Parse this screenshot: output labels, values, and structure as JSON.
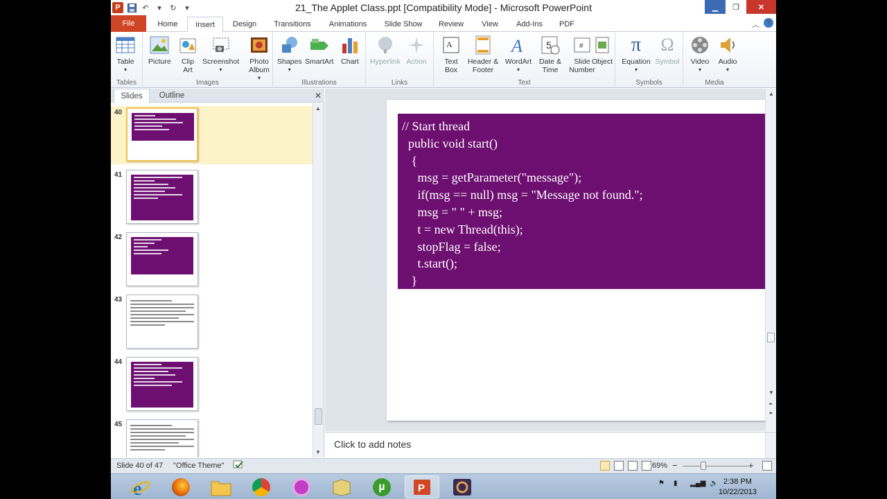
{
  "window": {
    "title": "21_The Applet Class.ppt [Compatibility Mode]  -  Microsoft PowerPoint",
    "app_letter": "P"
  },
  "tabs": [
    "File",
    "Home",
    "Insert",
    "Design",
    "Transitions",
    "Animations",
    "Slide Show",
    "Review",
    "View",
    "Add-Ins",
    "PDF"
  ],
  "active_tab": "Insert",
  "ribbon": {
    "groups": [
      {
        "label": "Tables",
        "buttons": [
          "Table"
        ]
      },
      {
        "label": "Images",
        "buttons": [
          "Picture",
          "Clip Art",
          "Screenshot",
          "Photo Album"
        ]
      },
      {
        "label": "Illustrations",
        "buttons": [
          "Shapes",
          "SmartArt",
          "Chart"
        ]
      },
      {
        "label": "Links",
        "buttons": [
          "Hyperlink",
          "Action"
        ]
      },
      {
        "label": "Text",
        "buttons": [
          "Text Box",
          "Header & Footer",
          "WordArt",
          "Date & Time",
          "Slide Number",
          "Object"
        ]
      },
      {
        "label": "Symbols",
        "buttons": [
          "Equation",
          "Symbol"
        ]
      },
      {
        "label": "Media",
        "buttons": [
          "Video",
          "Audio"
        ]
      }
    ]
  },
  "left_pane": {
    "tabs": [
      "Slides",
      "Outline"
    ],
    "active": "Slides",
    "thumbnails": [
      {
        "number": "40",
        "style": "purple",
        "selected": true
      },
      {
        "number": "41",
        "style": "purple",
        "selected": false
      },
      {
        "number": "42",
        "style": "purple",
        "selected": false
      },
      {
        "number": "43",
        "style": "text",
        "selected": false
      },
      {
        "number": "44",
        "style": "purple",
        "selected": false
      },
      {
        "number": "45",
        "style": "text",
        "selected": false
      }
    ]
  },
  "slide": {
    "code_lines": [
      "// Start thread",
      "  public void start()",
      "   {",
      "     msg = getParameter(\"message\");",
      "     if(msg == null) msg = \"Message not found.\";",
      "     msg = \" \" + msg;",
      "     t = new Thread(this);",
      "     stopFlag = false;",
      "     t.start();",
      "   }"
    ],
    "box_color": "#6d0f70"
  },
  "notes": {
    "placeholder": "Click to add notes"
  },
  "status": {
    "slide_info": "Slide 40 of 47",
    "theme": "\"Office Theme\"",
    "zoom": "69%",
    "zoom_minus": "−",
    "zoom_plus": "+"
  },
  "taskbar": {
    "time": "2:38 PM",
    "date": "10/22/2013"
  }
}
